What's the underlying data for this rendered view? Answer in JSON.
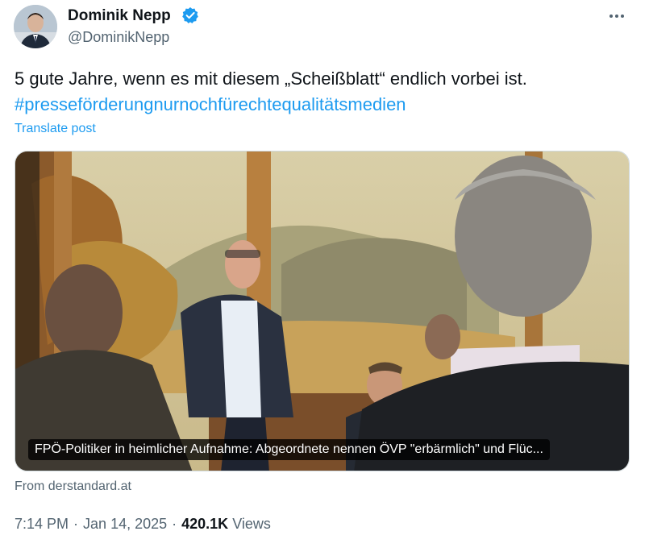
{
  "author": {
    "display_name": "Dominik Nepp",
    "handle": "@DominikNepp",
    "verified": true
  },
  "post": {
    "text": "5 gute Jahre, wenn es mit diesem „Scheißblatt“ endlich vorbei ist.",
    "hashtag": "#presseförderungnurnochfürechtequalitätsmedien",
    "translate_label": "Translate post"
  },
  "card": {
    "caption": "FPÖ-Politiker in heimlicher Aufnahme: Abgeordnete nennen ÖVP \"erbärmlich\" und Flüc...",
    "source": "From derstandard.at"
  },
  "meta": {
    "time": "7:14 PM",
    "separator": "·",
    "date": "Jan 14, 2025",
    "views_count": "420.1K",
    "views_label": "Views"
  },
  "icons": {
    "more": "more-options-icon",
    "verified": "verified-badge-icon"
  },
  "colors": {
    "link": "#1d9bf0",
    "text": "#0f1419",
    "secondary": "#536471"
  }
}
